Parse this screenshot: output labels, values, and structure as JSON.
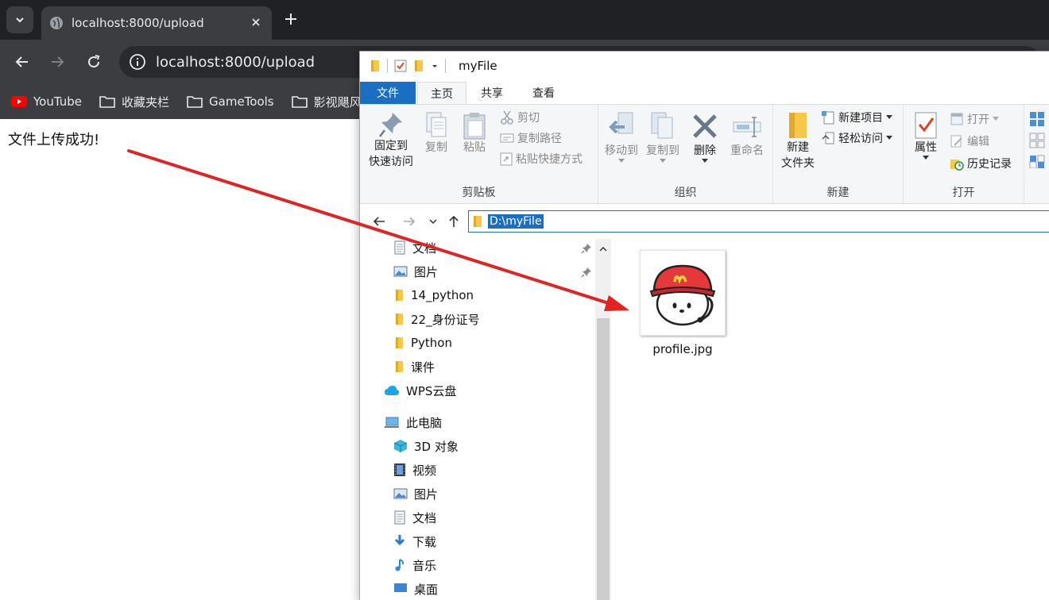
{
  "browser": {
    "tab_title": "localhost:8000/upload",
    "url": "localhost:8000/upload",
    "bookmarks": [
      {
        "label": "YouTube",
        "icon": "youtube-icon"
      },
      {
        "label": "收藏夹栏",
        "icon": "folder-icon"
      },
      {
        "label": "GameTools",
        "icon": "folder-icon"
      },
      {
        "label": "影视飓风",
        "icon": "folder-icon"
      }
    ]
  },
  "page": {
    "message": "文件上传成功!"
  },
  "explorer": {
    "title": "myFile",
    "tabs": {
      "file": "文件",
      "home": "主页",
      "share": "共享",
      "view": "查看"
    },
    "ribbon": {
      "clipboard": {
        "label": "剪贴板",
        "pin_line1": "固定到",
        "pin_line2": "快速访问",
        "copy": "复制",
        "paste": "粘贴",
        "cut": "剪切",
        "copy_path": "复制路径",
        "paste_shortcut": "粘贴快捷方式"
      },
      "organize": {
        "label": "组织",
        "move_to": "移动到",
        "copy_to": "复制到",
        "delete": "删除",
        "rename": "重命名"
      },
      "new": {
        "label": "新建",
        "new_folder_line1": "新建",
        "new_folder_line2": "文件夹",
        "new_item": "新建项目",
        "easy_access": "轻松访问"
      },
      "open": {
        "label": "打开",
        "properties": "属性",
        "open": "打开",
        "edit": "编辑",
        "history": "历史记录"
      }
    },
    "address": "D:\\myFile",
    "nav": {
      "pinned": [
        "文档",
        "图片",
        "14_python",
        "22_身份证号",
        "Python",
        "课件"
      ],
      "wps": "WPS云盘",
      "this_pc": "此电脑",
      "pc_items": [
        "3D 对象",
        "视频",
        "图片",
        "文档",
        "下载",
        "音乐",
        "桌面"
      ]
    },
    "files": [
      {
        "name": "profile.jpg"
      }
    ]
  },
  "colors": {
    "chrome_dark": "#202124",
    "chrome_toolbar": "#3c3d40",
    "accent_blue": "#1a6fc2",
    "annotation_arrow": "#e02424"
  }
}
